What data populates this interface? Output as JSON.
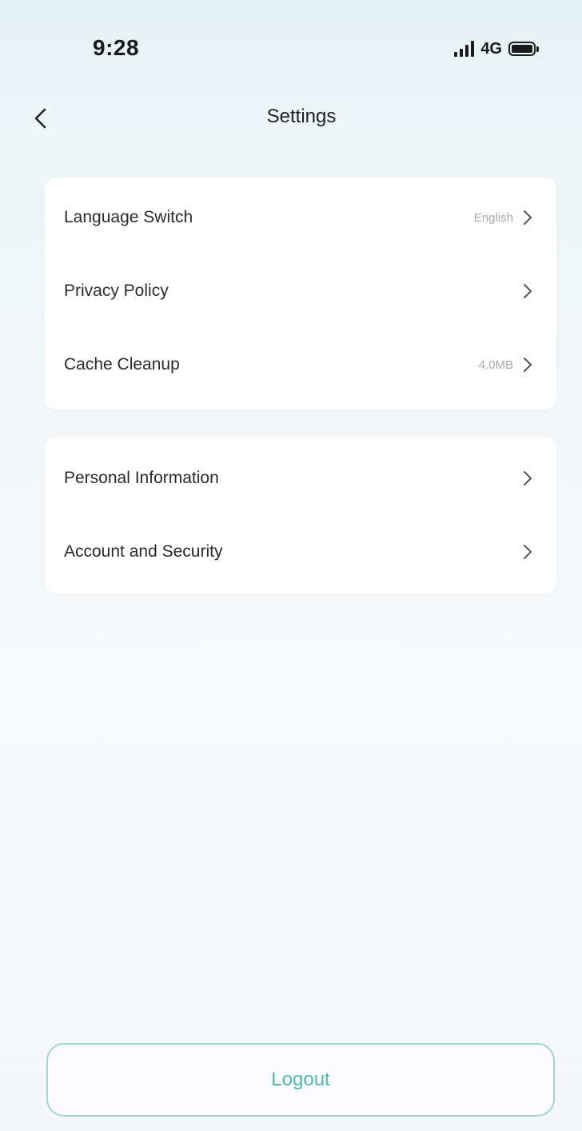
{
  "status_bar": {
    "time": "9:28",
    "network": "4G",
    "icons": [
      "signal-icon",
      "battery-icon"
    ]
  },
  "nav": {
    "title": "Settings",
    "back_icon": "chevron-left-icon"
  },
  "groups": [
    {
      "items": [
        {
          "label": "Language Switch",
          "value": "English"
        },
        {
          "label": "Privacy Policy",
          "value": ""
        },
        {
          "label": "Cache Cleanup",
          "value": "4.0MB"
        }
      ]
    },
    {
      "items": [
        {
          "label": "Personal Information",
          "value": ""
        },
        {
          "label": "Account and Security",
          "value": ""
        }
      ]
    }
  ],
  "logout": {
    "label": "Logout"
  },
  "colors": {
    "accent": "#4dbab0",
    "accent_border": "#9fd6d0",
    "muted_text": "#a9a9a9",
    "card_bg": "#ffffff"
  }
}
